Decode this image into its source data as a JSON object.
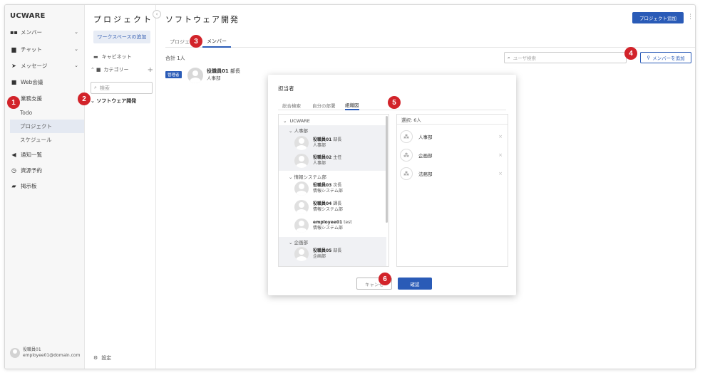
{
  "nav": {
    "brand": "UCWARE",
    "items": [
      {
        "label": "メンバー",
        "icon": "members-icon",
        "chevron": "⌄"
      },
      {
        "label": "チャット",
        "icon": "chat-icon",
        "chevron": "⌄"
      },
      {
        "label": "メッセージ",
        "icon": "send-icon",
        "chevron": "⌄"
      },
      {
        "label": "Web会議",
        "icon": "video-icon",
        "chevron": ""
      },
      {
        "label": "業務支援",
        "icon": "work-icon",
        "chevron": ""
      }
    ],
    "sub_items": [
      "Todo",
      "プロジェクト",
      "スケジュール"
    ],
    "items2": [
      {
        "label": "通知一覧",
        "icon": "megaphone-icon"
      },
      {
        "label": "資源予約",
        "icon": "clock-icon"
      },
      {
        "label": "掲示板",
        "icon": "board-icon"
      }
    ],
    "user": {
      "name": "役職員01",
      "email": "employee01@domain.com"
    }
  },
  "project_panel": {
    "title": "プロジェクト",
    "workspace_button": "ワークスペースの追加",
    "cabinet": "キャビネット",
    "category": "カテゴリー",
    "category_plus": "+",
    "search_placeholder": "検索",
    "tree_root": "ソフトウェア開発",
    "settings": "設定",
    "collapse": "‹"
  },
  "main": {
    "title": "ソフトウェア開発",
    "add_project": "プロジェクト追加",
    "kebab": "⋮",
    "tabs": [
      "プロジェ",
      "メンバー"
    ],
    "total": "合計 1人",
    "user_search_placeholder": "ユーザ検索",
    "add_member": "メンバーを追加",
    "member": {
      "badge": "管理者",
      "name": "役職員01",
      "title": "部長",
      "dept": "人事部"
    }
  },
  "modal": {
    "title": "担当者",
    "tabs": [
      "総合検索",
      "自分の部署",
      "組織図"
    ],
    "org": {
      "root": "UCWARE",
      "groups": [
        {
          "name": "人事部",
          "users": [
            {
              "name": "役職員01",
              "title": "部長",
              "dept": "人事部"
            },
            {
              "name": "役職員02",
              "title": "主任",
              "dept": "人事部"
            }
          ]
        },
        {
          "name": "情報システム部",
          "users": [
            {
              "name": "役職員03",
              "title": "次長",
              "dept": "情報システム部"
            },
            {
              "name": "役職員04",
              "title": "課長",
              "dept": "情報システム部"
            },
            {
              "name": "employee01",
              "title": "test",
              "dept": "情報システム部"
            }
          ]
        },
        {
          "name": "企画部",
          "users": [
            {
              "name": "役職員05",
              "title": "部長",
              "dept": "企画部"
            }
          ]
        }
      ]
    },
    "selected_header": "選択: 6人",
    "selected": [
      "人事部",
      "企画部",
      "法務部"
    ],
    "remove": "×",
    "cancel": "キャンセ",
    "confirm": "確認"
  },
  "markers": [
    "1",
    "2",
    "3",
    "4",
    "5",
    "6"
  ],
  "colors": {
    "accent": "#2a5bb7",
    "marker": "#d2232a"
  }
}
